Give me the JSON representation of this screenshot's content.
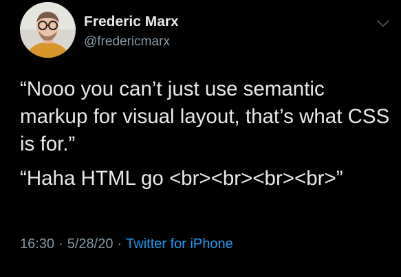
{
  "author": {
    "display_name": "Frederic Marx",
    "handle": "@fredericmarx"
  },
  "tweet": {
    "paragraphs": [
      "“Nooo you can’t just use semantic markup for visual layout, that’s what CSS is for.”",
      "“Haha HTML go <br><br><br><br>”"
    ]
  },
  "meta": {
    "time": "16:30",
    "date": "5/28/20",
    "separator": "·",
    "source": "Twitter for iPhone"
  },
  "icons": {
    "menu": "chevron-down-icon"
  },
  "colors": {
    "background": "#000000",
    "primary_text": "#e7e9ea",
    "secondary_text": "#8899a6",
    "link": "#1d9bf0"
  }
}
